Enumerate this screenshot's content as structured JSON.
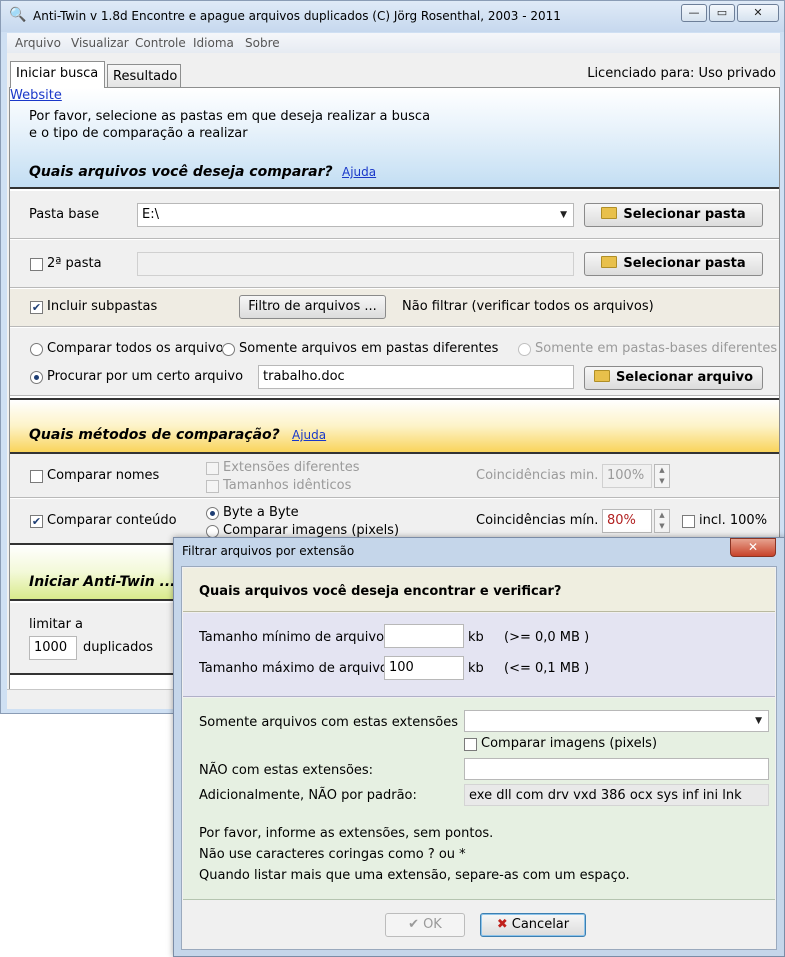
{
  "window": {
    "title": "Anti-Twin    v 1.8d     Encontre e apague arquivos duplicados    (C) Jörg Rosenthal, 2003 - 2011",
    "controls": {
      "minimize": "—",
      "maximize": "▭",
      "close": "✕"
    }
  },
  "menu": [
    "Arquivo",
    "Visualizar",
    "Controle",
    "Idioma",
    "Sobre"
  ],
  "tabs": [
    {
      "label": "Iniciar busca",
      "active": true
    },
    {
      "label": "Resultado",
      "active": false
    }
  ],
  "license": "Licenciado para: Uso privado",
  "intro": {
    "line1": "Por favor, selecione as pastas em que deseja realizar a busca",
    "line2": "e o tipo de comparação a realizar",
    "website_link": "Website"
  },
  "files_section": {
    "title": "Quais arquivos você deseja comparar?",
    "help_link": "Ajuda",
    "base_folder_label": "Pasta base",
    "base_folder_value": "E:\\",
    "select_folder_label": "Selecionar pasta",
    "second_folder_label": "2ª pasta",
    "second_folder_checked": false,
    "second_folder_value": "",
    "include_subfolders_label": "Incluir subpastas",
    "include_subfolders_checked": true,
    "file_filter_button": "Filtro de arquivos ...",
    "filter_status": "Não filtrar (verificar todos os arquivos)",
    "radio_compare_all": "Comparar todos os arquivos",
    "radio_different_folders": "Somente arquivos em pastas diferentes",
    "radio_base_folders": "Somente em pastas-bases diferentes",
    "radio_search_file": "Procurar por um certo arquivo",
    "search_file_value": "trabalho.doc",
    "select_file_label": "Selecionar arquivo"
  },
  "methods_section": {
    "title": "Quais métodos de comparação?",
    "help_link": "Ajuda",
    "compare_names_label": "Comparar nomes",
    "compare_names_checked": false,
    "different_extensions": "Extensões diferentes",
    "identical_sizes": "Tamanhos idênticos",
    "min_matches_label": "Coincidências min.",
    "min_matches_value": "100%",
    "compare_content_label": "Comparar conteúdo",
    "compare_content_checked": true,
    "byte_by_byte": "Byte a Byte",
    "compare_images": "Comparar imagens (pixels)",
    "content_matches_label": "Coincidências mín.",
    "content_matches_value": "80%",
    "incl_100_label": "incl. 100%",
    "incl_100_checked": false
  },
  "start_section": {
    "title": "Iniciar Anti-Twin ...",
    "limit_label": "limitar a",
    "limit_value": "1000",
    "duplicates_label": "duplicados"
  },
  "dialog": {
    "title": "Filtrar arquivos por extensão",
    "close": "✕",
    "heading": "Quais arquivos você deseja encontrar e verificar?",
    "min_size_label": "Tamanho mínimo de arquivo",
    "min_size_value": "",
    "min_size_unit": "kb",
    "min_size_hint": "(>= 0,0 MB )",
    "max_size_label": "Tamanho máximo de arquivo",
    "max_size_value": "100",
    "max_size_unit": "kb",
    "max_size_hint": "(<= 0,1 MB )",
    "only_ext_label": "Somente arquivos com estas extensões",
    "only_ext_value": "",
    "compare_images_label": "Comparar imagens (pixels)",
    "compare_images_checked": false,
    "not_ext_label": "NÃO com estas extensões:",
    "not_ext_value": "",
    "default_excluded_label": "Adicionalmente, NÃO por padrão:",
    "default_excluded_value": "exe dll com drv vxd 386 ocx sys inf ini lnk",
    "note1": "Por favor, informe as extensões, sem pontos.",
    "note2": "Não use caracteres coringas como ? ou *",
    "note3": "Quando listar mais que uma extensão, separe-as com um espaço.",
    "ok_label": "OK",
    "cancel_label": "Cancelar"
  }
}
